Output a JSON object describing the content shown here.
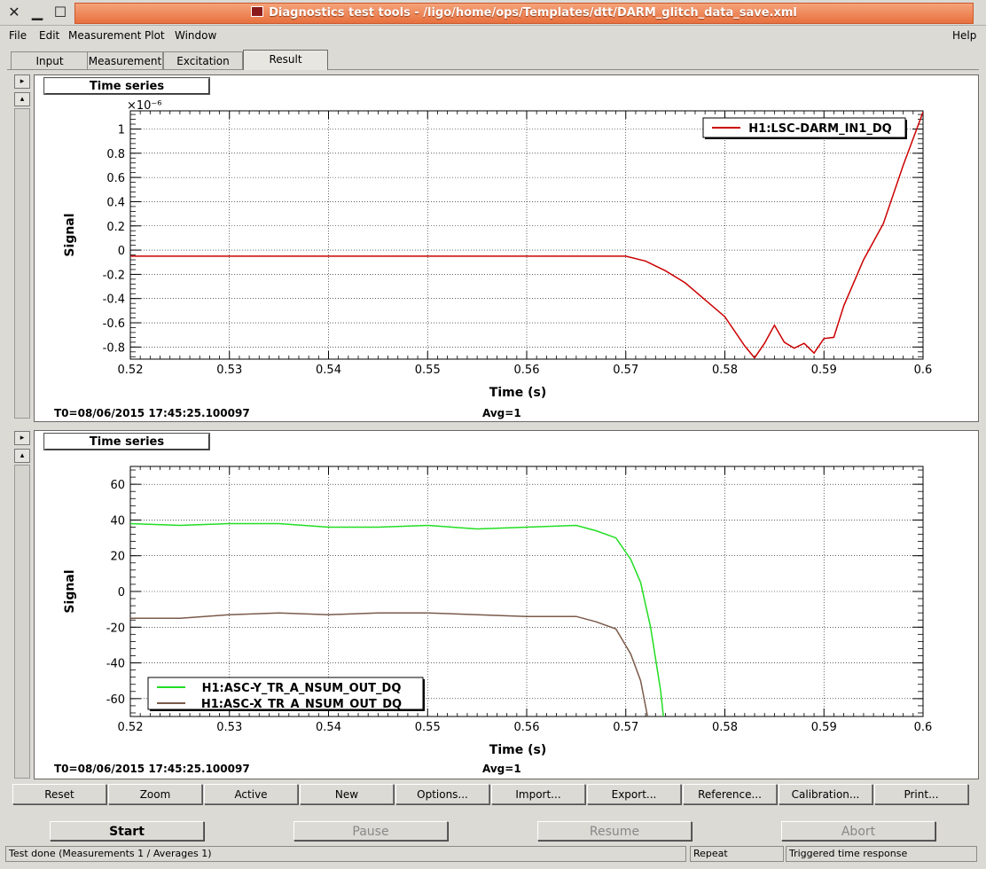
{
  "window": {
    "title": "Diagnostics test tools - /ligo/home/ops/Templates/dtt/DARM_glitch_data_save.xml",
    "close_glyph": "✕",
    "minimize_glyph": "▁",
    "maximize_glyph": "☐"
  },
  "menu": {
    "file": "File",
    "edit": "Edit",
    "measurement": "Measurement",
    "plot": "Plot",
    "window": "Window",
    "help": "Help"
  },
  "tabs": [
    "Input",
    "Measurement",
    "Excitation",
    "Result"
  ],
  "active_tab": "Result",
  "panel1": {
    "title": "Time series",
    "t0": "T0=08/06/2015 17:45:25.100097",
    "avg": "Avg=1"
  },
  "panel2": {
    "title": "Time series",
    "t0": "T0=08/06/2015 17:45:25.100097",
    "avg": "Avg=1"
  },
  "toolbar": [
    "Reset",
    "Zoom",
    "Active",
    "New",
    "Options...",
    "Import...",
    "Export...",
    "Reference...",
    "Calibration...",
    "Print..."
  ],
  "controls": {
    "start": "Start",
    "pause": "Pause",
    "resume": "Resume",
    "abort": "Abort"
  },
  "status": {
    "message": "Test done (Measurements 1 / Averages 1)",
    "repeat": "Repeat",
    "mode": "Triggered time response"
  },
  "chart_data": [
    {
      "type": "line",
      "title": "",
      "xlabel": "Time (s)",
      "ylabel": "Signal",
      "y_multiplier": "×10⁻⁶",
      "xlim": [
        0.52,
        0.6
      ],
      "ylim": [
        -0.9,
        1.15
      ],
      "xticks": [
        0.52,
        0.53,
        0.54,
        0.55,
        0.56,
        0.57,
        0.58,
        0.59,
        0.6
      ],
      "yticks": [
        -0.8,
        -0.6,
        -0.4,
        -0.2,
        0,
        0.2,
        0.4,
        0.6,
        0.8,
        1
      ],
      "grid": true,
      "legend_position": "top-right",
      "series": [
        {
          "name": "H1:LSC-DARM_IN1_DQ",
          "color": "#cc0000",
          "x": [
            0.52,
            0.53,
            0.54,
            0.55,
            0.56,
            0.565,
            0.57,
            0.572,
            0.574,
            0.576,
            0.578,
            0.58,
            0.582,
            0.583,
            0.584,
            0.585,
            0.586,
            0.587,
            0.588,
            0.589,
            0.59,
            0.591,
            0.592,
            0.594,
            0.596,
            0.598,
            0.6
          ],
          "y": [
            -0.05,
            -0.05,
            -0.05,
            -0.05,
            -0.05,
            -0.05,
            -0.05,
            -0.09,
            -0.17,
            -0.27,
            -0.41,
            -0.55,
            -0.79,
            -0.89,
            -0.77,
            -0.62,
            -0.76,
            -0.81,
            -0.77,
            -0.85,
            -0.73,
            -0.72,
            -0.46,
            -0.08,
            0.22,
            0.7,
            1.14
          ]
        }
      ]
    },
    {
      "type": "line",
      "title": "",
      "xlabel": "Time (s)",
      "ylabel": "Signal",
      "xlim": [
        0.52,
        0.6
      ],
      "ylim": [
        -70,
        70
      ],
      "xticks": [
        0.52,
        0.53,
        0.54,
        0.55,
        0.56,
        0.57,
        0.58,
        0.59,
        0.6
      ],
      "yticks": [
        -60,
        -40,
        -20,
        0,
        20,
        40,
        60
      ],
      "grid": true,
      "legend_position": "bottom-left",
      "series": [
        {
          "name": "H1:ASC-Y_TR_A_NSUM_OUT_DQ",
          "color": "#22dd22",
          "x": [
            0.52,
            0.525,
            0.53,
            0.535,
            0.54,
            0.545,
            0.55,
            0.555,
            0.56,
            0.565,
            0.567,
            0.569,
            0.5705,
            0.5715,
            0.5725,
            0.5735,
            0.5738
          ],
          "y": [
            38,
            37,
            38,
            38,
            36,
            36,
            37,
            35,
            36,
            37,
            34,
            30,
            18,
            5,
            -20,
            -55,
            -70
          ]
        },
        {
          "name": "H1:ASC-X_TR_A_NSUM_OUT_DQ",
          "color": "#7a5a4a",
          "x": [
            0.52,
            0.525,
            0.53,
            0.535,
            0.54,
            0.545,
            0.55,
            0.555,
            0.56,
            0.565,
            0.567,
            0.569,
            0.5705,
            0.5715,
            0.5722
          ],
          "y": [
            -15,
            -15,
            -13,
            -12,
            -13,
            -12,
            -12,
            -13,
            -14,
            -14,
            -17,
            -21,
            -35,
            -50,
            -70
          ]
        }
      ]
    }
  ]
}
